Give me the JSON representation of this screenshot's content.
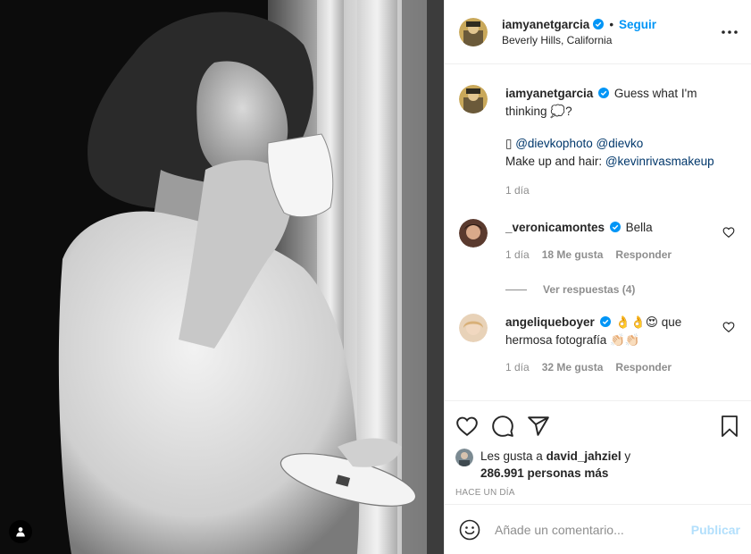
{
  "post": {
    "username": "iamyanetgarcia",
    "dot": "•",
    "follow_label": "Seguir",
    "location": "Beverly Hills, California"
  },
  "caption": {
    "username": "iamyanetgarcia",
    "text_1": "Guess what I'm thinking 💭?",
    "camera_glyph": "▯",
    "mention_1": "@dievkophoto",
    "mention_2": "@dievko",
    "makeup_label": "Make up and hair:",
    "mention_3": "@kevinrivasmakeup",
    "time": "1 día"
  },
  "comments": [
    {
      "username": "_veronicamontes",
      "text": "Bella",
      "time": "1 día",
      "likes": "18 Me gusta",
      "reply_label": "Responder",
      "view_replies": "Ver respuestas (4)"
    },
    {
      "username": "angeliqueboyer",
      "text": "👌👌😍 que hermosa fotografía 👏🏻👏🏻",
      "time": "1 día",
      "likes": "32 Me gusta",
      "reply_label": "Responder"
    }
  ],
  "likes_block": {
    "prefix": "Les gusta a",
    "liker": "david_jahziel",
    "suffix": "y",
    "others": "286.991 personas más"
  },
  "timestamp": "HACE UN DÍA",
  "add_comment": {
    "placeholder": "Añade un comentario...",
    "publish_label": "Publicar"
  },
  "colors": {
    "accent_blue": "#0095f6",
    "mention_blue": "#00376b",
    "publish_disabled": "#b2dffc",
    "muted": "#8e8e8e"
  },
  "icons": {
    "like": "heart-icon",
    "comment": "comment-icon",
    "share": "paper-plane-icon",
    "save": "bookmark-icon",
    "emoji": "smiley-icon",
    "more": "ellipsis-icon",
    "user_tag": "person-icon"
  }
}
